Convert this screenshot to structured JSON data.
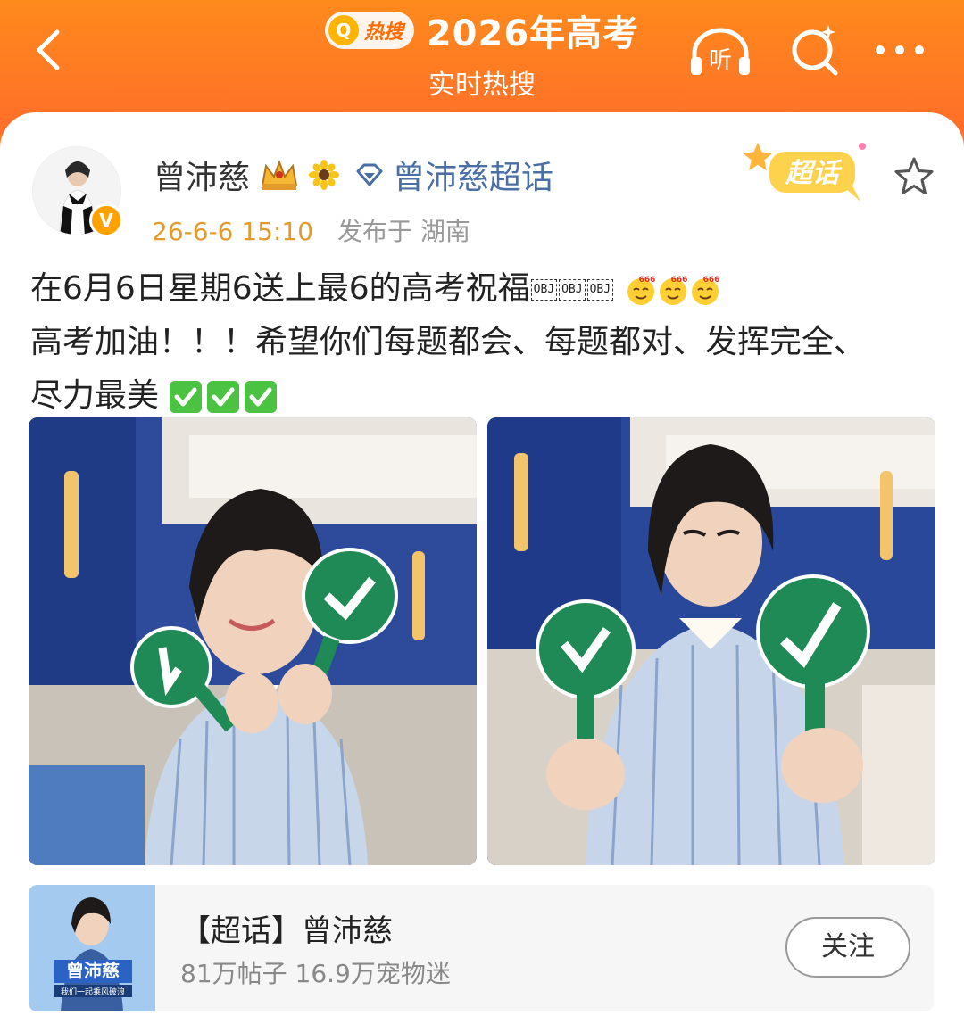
{
  "header": {
    "hot_badge": "热搜",
    "title": "2026年高考",
    "subtitle": "实时热搜",
    "listen_label": "听"
  },
  "post": {
    "user_name": "曾沛慈",
    "topic_link": "曾沛慈超话",
    "verified_mark": "V",
    "timestamp": "26-6-6 15:10",
    "location": "发布于 湖南",
    "supertag_label": "超话",
    "text_line1": "在6月6日星期6送上最6的高考祝福",
    "obj_tokens": [
      "OBJ",
      "OBJ",
      "OBJ"
    ],
    "emoji_badge": "666",
    "text_line2": "高考加油！！！希望你们每题都会、每题都对、发挥完全、",
    "text_line3": "尽力最美"
  },
  "topic_card": {
    "title": "【超话】曾沛慈",
    "stats": "81万帖子 16.9万宠物迷",
    "follow_label": "关注",
    "thumb_name": "曾沛慈",
    "thumb_sub": "我们一起乘风破浪"
  },
  "colors": {
    "header_orange": "#ff7a22",
    "link_blue": "#4a6fa5",
    "time_orange": "#e39a2c",
    "check_green": "#1f8a55"
  }
}
